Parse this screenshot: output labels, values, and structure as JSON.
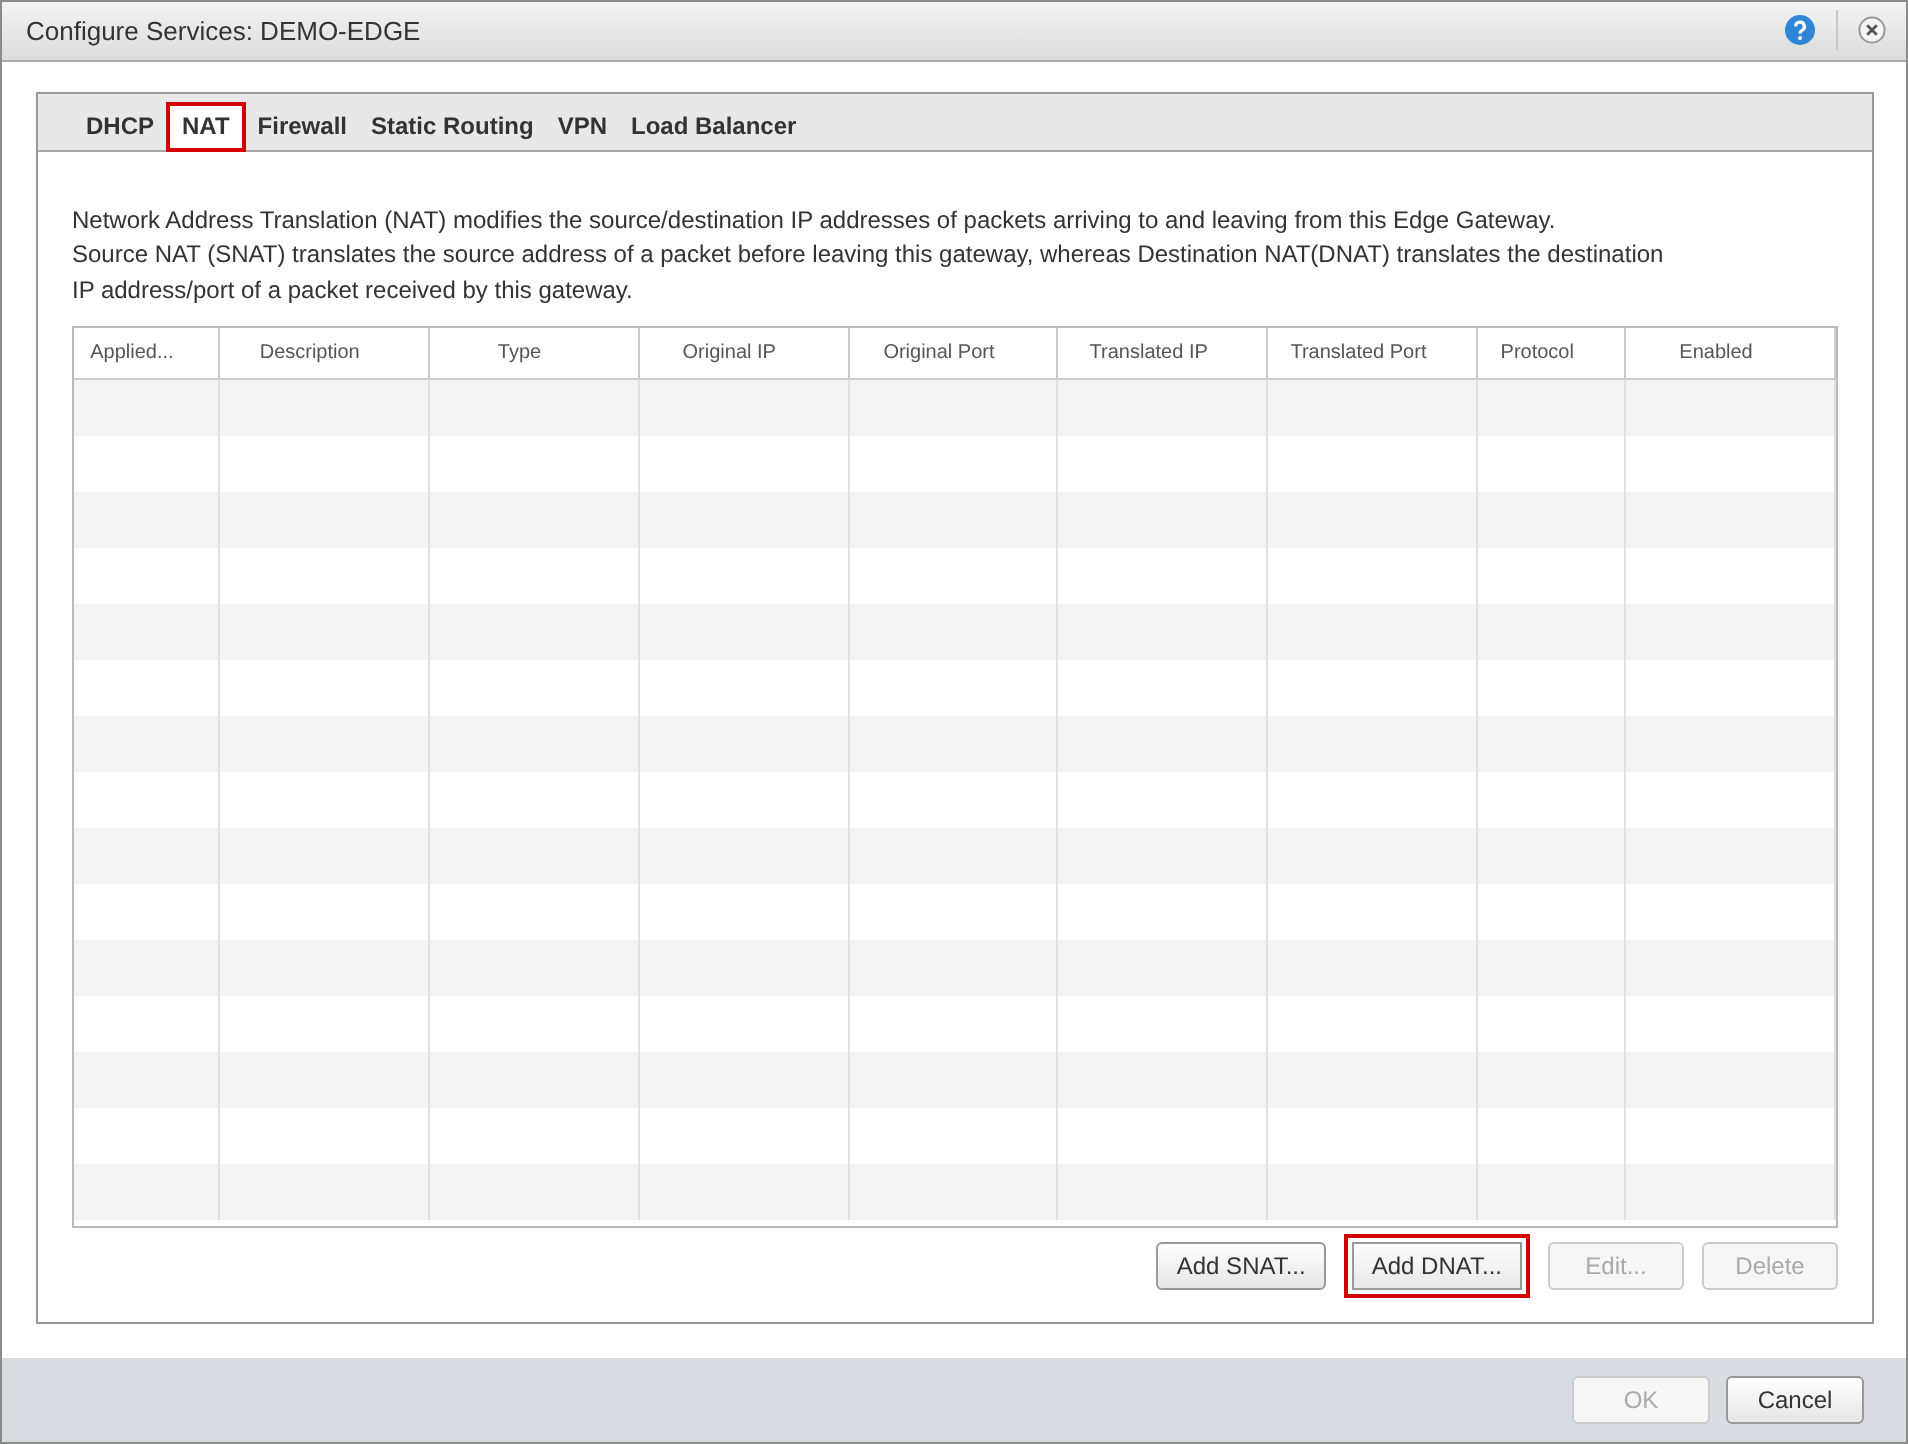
{
  "window": {
    "title": "Configure Services: DEMO-EDGE"
  },
  "tabs": [
    {
      "label": "DHCP",
      "selected": false,
      "highlighted": false
    },
    {
      "label": "NAT",
      "selected": true,
      "highlighted": true
    },
    {
      "label": "Firewall",
      "selected": false,
      "highlighted": false
    },
    {
      "label": "Static Routing",
      "selected": false,
      "highlighted": false
    },
    {
      "label": "VPN",
      "selected": false,
      "highlighted": false
    },
    {
      "label": "Load Balancer",
      "selected": false,
      "highlighted": false
    }
  ],
  "description": [
    "Network Address Translation (NAT) modifies the source/destination IP addresses of packets arriving to and leaving from this Edge Gateway.",
    "Source NAT (SNAT) translates the source address of a packet before leaving this gateway, whereas Destination NAT(DNAT)  translates the destination IP address/port of a packet received by this gateway."
  ],
  "table": {
    "columns": [
      "Applied...",
      "Description",
      "Type",
      "Original IP",
      "Original Port",
      "Translated IP",
      "Translated Port",
      "Protocol",
      "Enabled"
    ]
  },
  "actions": [
    {
      "label": "Add SNAT...",
      "disabled": false,
      "highlighted": false
    },
    {
      "label": "Add DNAT...",
      "disabled": false,
      "highlighted": true
    },
    {
      "label": "Edit...",
      "disabled": true,
      "highlighted": false
    },
    {
      "label": "Delete",
      "disabled": true,
      "highlighted": false
    }
  ],
  "footer_buttons": [
    {
      "label": "OK",
      "disabled": true
    },
    {
      "label": "Cancel",
      "disabled": false
    }
  ]
}
